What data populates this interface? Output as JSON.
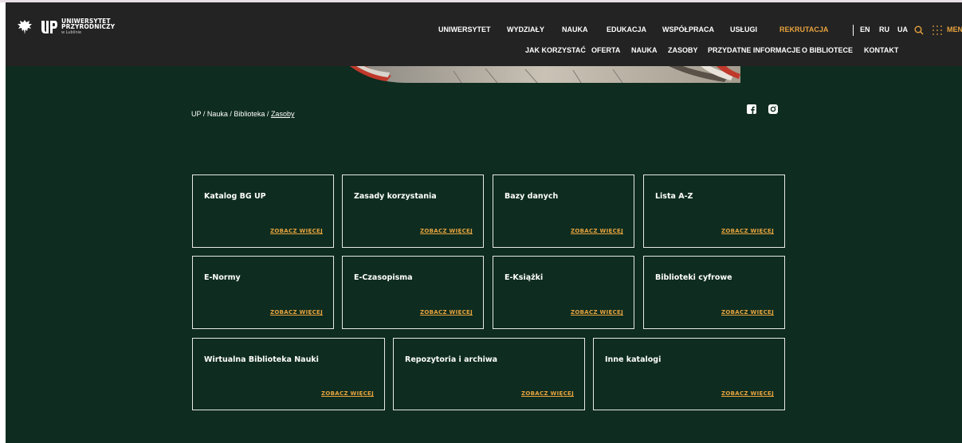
{
  "logo": {
    "line1": "UNIWERSYTET",
    "line2": "PRZYRODNICZY",
    "line3": "w Lublinie"
  },
  "nav_primary": [
    {
      "label": "UNIWERSYTET"
    },
    {
      "label": "WYDZIAŁY"
    },
    {
      "label": "NAUKA"
    },
    {
      "label": "EDUKACJA"
    },
    {
      "label": "WSPÓŁPRACA"
    },
    {
      "label": "USŁUGI"
    },
    {
      "label": "REKRUTACJA"
    },
    {
      "label": "EN"
    },
    {
      "label": "RU"
    },
    {
      "label": "UA"
    },
    {
      "label": "MENU"
    }
  ],
  "nav_secondary": [
    {
      "label": "JAK KORZYSTAĆ"
    },
    {
      "label": "OFERTA"
    },
    {
      "label": "NAUKA"
    },
    {
      "label": "ZASOBY"
    },
    {
      "label": "PRZYDATNE INFORMACJE"
    },
    {
      "label": "O BIBLIOTECE"
    },
    {
      "label": "KONTAKT"
    }
  ],
  "breadcrumb": {
    "items": [
      "UP",
      "Nauka",
      "Biblioteka"
    ],
    "separator": " / ",
    "current": "Zasoby"
  },
  "social": [
    "facebook-icon",
    "instagram-icon"
  ],
  "cards": [
    {
      "title": "Katalog BG UP",
      "link": "ZOBACZ WIĘCEJ"
    },
    {
      "title": "Zasady korzystania",
      "link": "ZOBACZ WIĘCEJ"
    },
    {
      "title": "Bazy danych",
      "link": "ZOBACZ WIĘCEJ"
    },
    {
      "title": "Lista A-Z",
      "link": "ZOBACZ WIĘCEJ"
    },
    {
      "title": "E-Normy",
      "link": "ZOBACZ WIĘCEJ"
    },
    {
      "title": "E-Czasopisma",
      "link": "ZOBACZ WIĘCEJ"
    },
    {
      "title": "E-Książki",
      "link": "ZOBACZ WIĘCEJ"
    },
    {
      "title": "Biblioteki cyfrowe",
      "link": "ZOBACZ WIĘCEJ"
    },
    {
      "title": "Wirtualna Biblioteka Nauki",
      "link": "ZOBACZ WIĘCEJ"
    },
    {
      "title": "Repozytoria i archiwa",
      "link": "ZOBACZ WIĘCEJ"
    },
    {
      "title": "Inne katalogi",
      "link": "ZOBACZ WIĘCEJ"
    }
  ],
  "colors": {
    "header_bg": "#232323",
    "main_bg": "#0e2c1f",
    "accent": "#e7a33e"
  }
}
